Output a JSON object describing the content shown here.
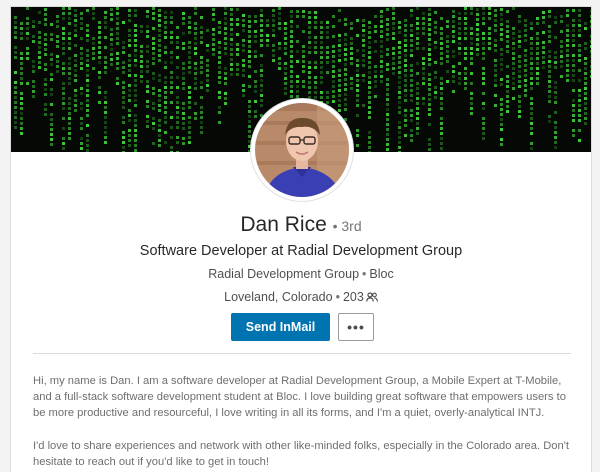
{
  "profile": {
    "name": "Dan Rice",
    "degree": "3rd",
    "headline": "Software Developer at Radial Development Group",
    "companies": [
      "Radial Development Group",
      "Bloc"
    ],
    "location": "Loveland, Colorado",
    "connections": "203",
    "connections_icon": "people-icon"
  },
  "actions": {
    "primary_label": "Send InMail",
    "more_label": "•••",
    "more_icon": "more-horizontal-icon"
  },
  "summary": {
    "paragraphs": [
      "Hi, my name is Dan. I am a software developer at Radial Development Group, a Mobile Expert at T-Mobile, and a full-stack software development student at Bloc. I love building great software that empowers users to be more productive and resourceful, I love writing in all its forms, and I'm a quiet, overly-analytical INTJ.",
      "I'd love to share experiences and network with other like-minded folks, especially in the Colorado area. Don't hesitate to reach out if you'd like to get in touch!"
    ]
  },
  "colors": {
    "accent": "#0073b1",
    "banner_bg": "#050805",
    "banner_glyph": "#3fcf3a"
  }
}
